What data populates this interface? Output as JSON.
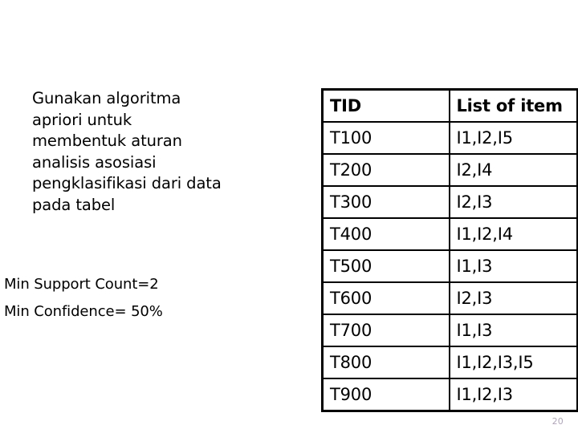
{
  "slide": {
    "background_color": "#ffffff",
    "page_number": "20",
    "page_number_color": "#b0a6bb"
  },
  "prompt": {
    "lines": [
      "Gunakan algoritma",
      "apriori untuk",
      "membentuk aturan",
      "analisis asosiasi",
      "pengklasifikasi dari data",
      "pada tabel"
    ]
  },
  "parameters": {
    "lines": [
      "Min Support Count=2",
      "Min Confidence= 50%"
    ]
  },
  "transactions_table": {
    "headers": [
      "TID",
      "List of item"
    ],
    "rows": [
      {
        "tid": "T100",
        "items": "I1,I2,I5"
      },
      {
        "tid": "T200",
        "items": "I2,I4"
      },
      {
        "tid": "T300",
        "items": "I2,I3"
      },
      {
        "tid": "T400",
        "items": "I1,I2,I4"
      },
      {
        "tid": "T500",
        "items": "I1,I3"
      },
      {
        "tid": "T600",
        "items": "I2,I3"
      },
      {
        "tid": "T700",
        "items": "I1,I3"
      },
      {
        "tid": "T800",
        "items": "I1,I2,I3,I5"
      },
      {
        "tid": "T900",
        "items": "I1,I2,I3"
      }
    ]
  }
}
